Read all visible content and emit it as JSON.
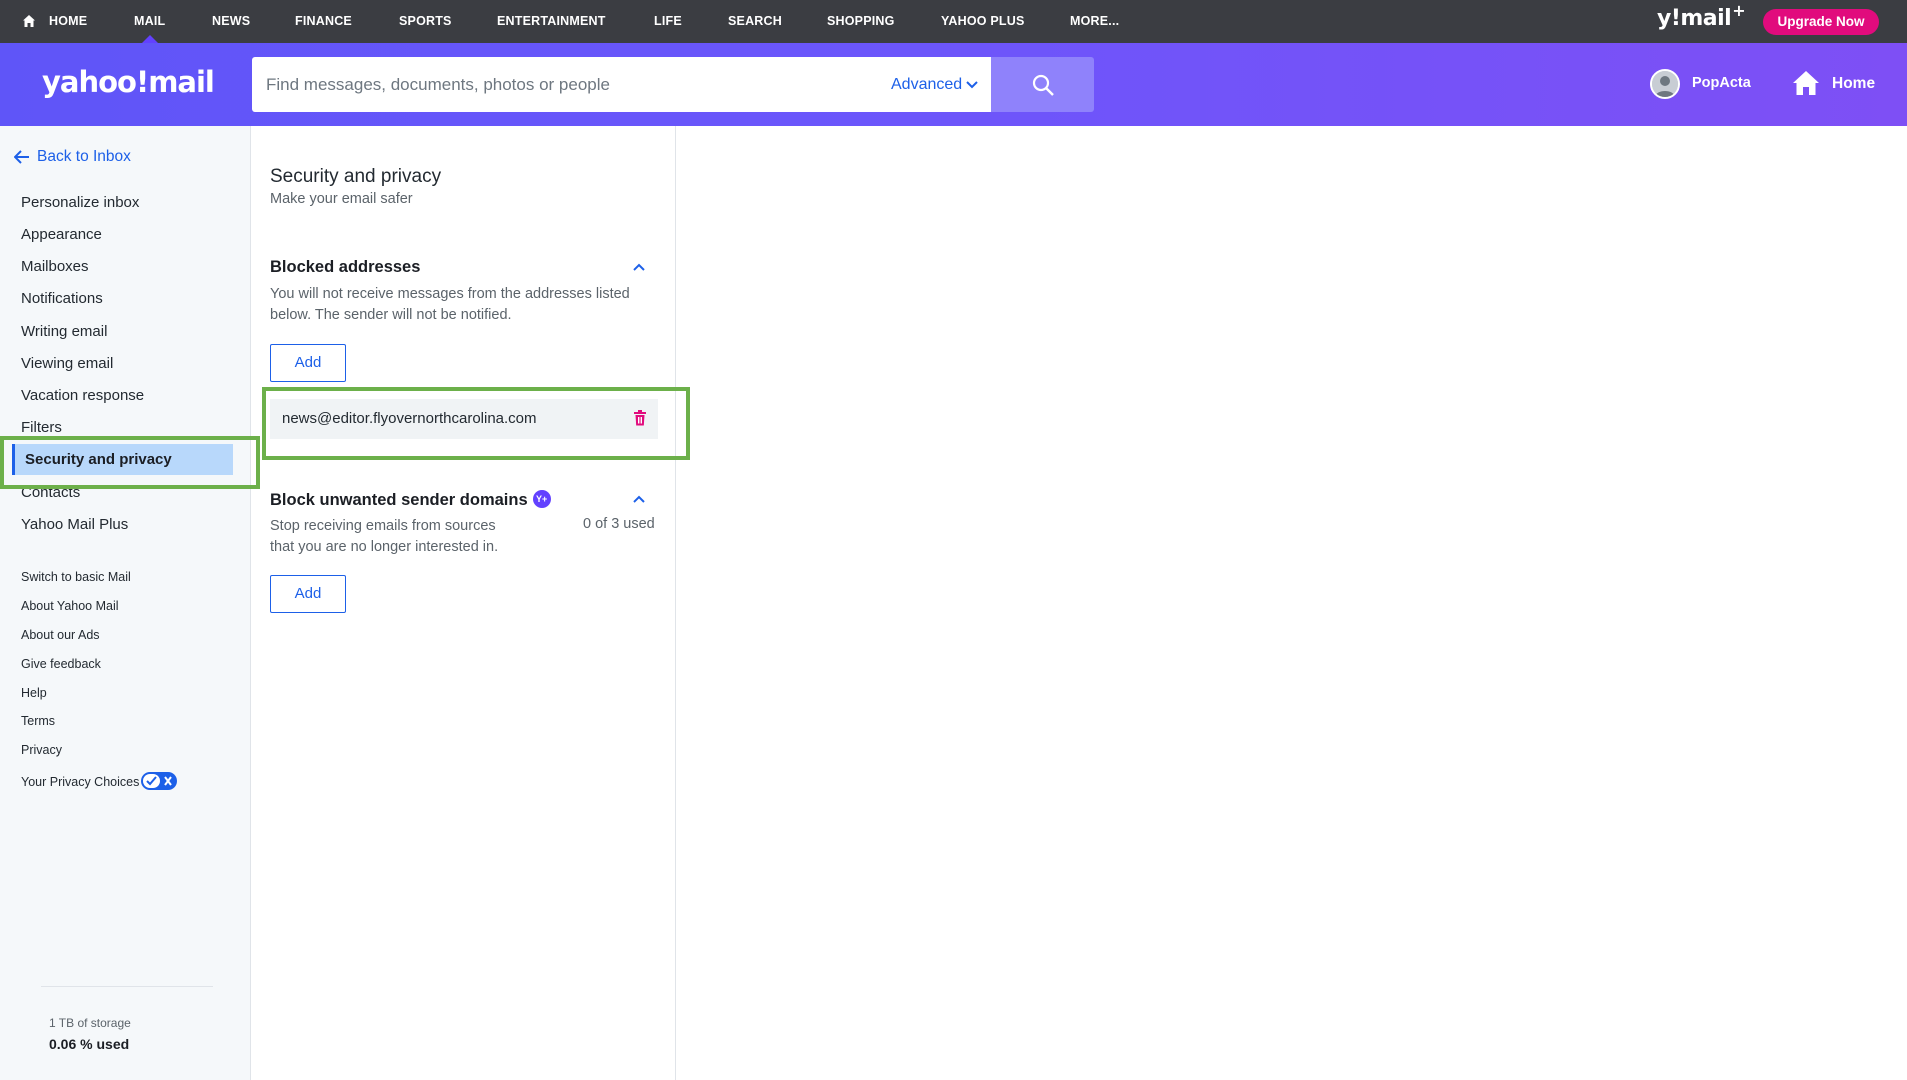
{
  "top_nav": {
    "items": [
      "HOME",
      "MAIL",
      "NEWS",
      "FINANCE",
      "SPORTS",
      "ENTERTAINMENT",
      "LIFE",
      "SEARCH",
      "SHOPPING",
      "YAHOO PLUS",
      "MORE..."
    ],
    "active": "MAIL",
    "brand": "y!mail",
    "brand_plus": "+",
    "upgrade_label": "Upgrade Now"
  },
  "header": {
    "logo": "yahoo!mail",
    "search_placeholder": "Find messages, documents, photos or people",
    "advanced_label": "Advanced",
    "profile_name": "PopActa",
    "home_label": "Home"
  },
  "sidebar": {
    "back_label": "Back to Inbox",
    "items": [
      "Personalize inbox",
      "Appearance",
      "Mailboxes",
      "Notifications",
      "Writing email",
      "Viewing email",
      "Vacation response",
      "Filters",
      "Security and privacy",
      "Contacts",
      "Yahoo Mail Plus"
    ],
    "selected": "Security and privacy",
    "links": [
      "Switch to basic Mail",
      "About Yahoo Mail",
      "About our Ads",
      "Give feedback",
      "Help",
      "Terms",
      "Privacy",
      "Your Privacy Choices"
    ],
    "storage_title": "1 TB of storage",
    "storage_used": "0.06 % used"
  },
  "panel": {
    "title": "Security and privacy",
    "subtitle": "Make your email safer",
    "blocked": {
      "title": "Blocked addresses",
      "description": "You will not receive messages from the addresses listed below. The sender will not be notified.",
      "add_label": "Add",
      "addresses": [
        "news@editor.flyovernorthcarolina.com"
      ]
    },
    "domains": {
      "title": "Block unwanted sender domains",
      "badge": "Y+",
      "description": "Stop receiving emails from sources that you are no longer interested in.",
      "usage": "0 of 3 used",
      "add_label": "Add"
    }
  },
  "colors": {
    "topnav_bg": "#3b3d42",
    "header_gradient_start": "#5f55f8",
    "header_gradient_end": "#7e4ff5",
    "accent_blue": "#1d60e8",
    "upgrade_pink": "#e10b7d",
    "trash_pink": "#e10b7d",
    "highlight_green": "#6cb04a",
    "selected_bg": "#b8d8fb"
  },
  "icons": [
    "home-icon",
    "search-icon",
    "chevron-down-icon",
    "user-avatar-icon",
    "house-icon",
    "arrow-left-icon",
    "chevron-up-icon",
    "trash-icon",
    "yahoo-plus-icon",
    "privacy-choices-icon"
  ]
}
